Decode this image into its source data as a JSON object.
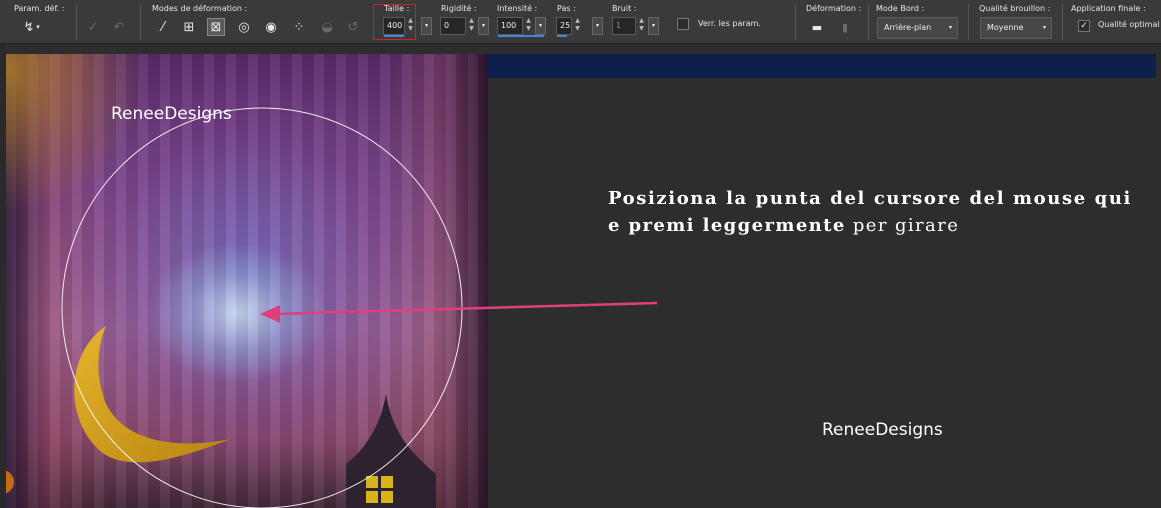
{
  "toolbar": {
    "presets_label": "Param. déf. :",
    "modes_label": "Modes de déformation :",
    "size_label": "Taille :",
    "size_value": "400",
    "hardness_label": "Rigidité :",
    "hardness_value": "0",
    "strength_label": "Intensité :",
    "strength_value": "100",
    "step_label": "Pas :",
    "step_value": "25",
    "noise_label": "Bruit :",
    "noise_value": "1",
    "lock_label": "Verr. les param.",
    "deformation_label": "Déformation :",
    "edge_mode_label": "Mode Bord :",
    "edge_mode_value": "Arrière-plan",
    "draft_quality_label": "Qualité brouillon :",
    "draft_quality_value": "Moyenne",
    "final_label": "Application finale :",
    "final_checkbox_label": "Qualité optimal",
    "final_checked": true
  },
  "annotation": {
    "instruction_line1": "Posiziona la punta del cursore del mouse qui",
    "instruction_line2_bold": "e premi leggermente",
    "instruction_line2_rest": " per girare",
    "arrow_color": "#e0407a",
    "highlight_color": "#d42020"
  },
  "watermarks": {
    "canvas": "ReneeDesigns",
    "background": "ReneeDesigns"
  },
  "icons": {
    "presets": "preset-brush-icon",
    "apply": "checkmark-icon",
    "reset": "reset-icon",
    "deformation_open": "folder-icon",
    "deformation_save": "save-icon"
  }
}
